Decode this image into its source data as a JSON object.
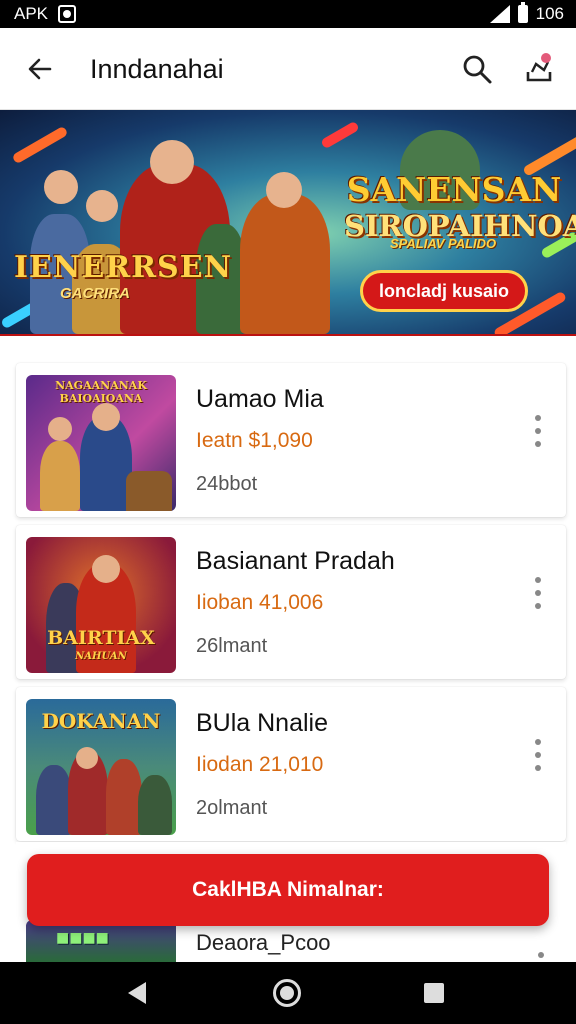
{
  "status_bar": {
    "left_text": "APK",
    "time": "106"
  },
  "app_bar": {
    "title": "Inndanahai"
  },
  "banner": {
    "left_title": "IENERRSEN",
    "left_subtitle": "GACRIRA",
    "right_title_line1": "SANENSAN",
    "right_title_line2": "SIROPAIHNOAN",
    "tagline": "SPALIAV PALIDO",
    "cta_label": "loncladj kusaio"
  },
  "products": [
    {
      "name": "Uamao Mia",
      "price": "Ieatn $1,090",
      "meta": "24bbot",
      "thumb_title": "NAGAANANAK BAIOAIOANA",
      "thumb_colors": [
        "#5a2a8a",
        "#c04aa0"
      ]
    },
    {
      "name": "Basianant Pradah",
      "price": "Iioban 41,006",
      "meta": "26lmant",
      "thumb_title": "BAIRTIAX",
      "thumb_sub": "NAHUAN",
      "thumb_colors": [
        "#8a1a3a",
        "#e0702a"
      ]
    },
    {
      "name": "BUla Nnalie",
      "price": "Iiodan 21,010",
      "meta": "2olmant",
      "thumb_title": "DOKANAN",
      "thumb_colors": [
        "#2a6a9a",
        "#4aa04a"
      ]
    }
  ],
  "partial_item": {
    "name": "Deaora_Pcoo"
  },
  "bottom_button": {
    "label": "CaklHBA Nimalnar:"
  },
  "colors": {
    "accent_red": "#e01e1e",
    "price_orange": "#d86a12"
  },
  "icons": [
    "back-arrow-icon",
    "search-icon",
    "cart-icon",
    "more-vert-icon",
    "nav-back-icon",
    "nav-home-icon",
    "nav-recents-icon"
  ]
}
